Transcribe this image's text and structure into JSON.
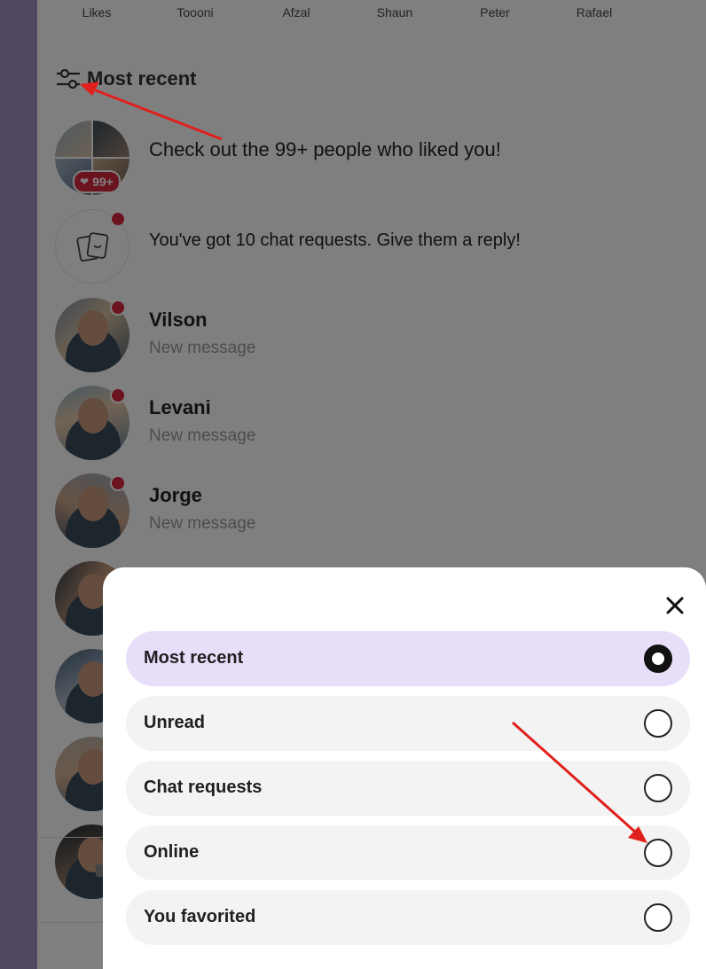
{
  "stories": [
    "Likes",
    "Toooni",
    "Afzal",
    "Shaun",
    "Peter",
    "Rafael"
  ],
  "filter": {
    "label": "Most recent",
    "icon": "sliders-icon"
  },
  "likes_row": {
    "text": "Check out the 99+ people who liked you!",
    "badge": "99+"
  },
  "requests_row": {
    "text": "You've got 10 chat requests. Give them a reply!",
    "icon": "chat-cards-icon"
  },
  "conversations": [
    {
      "name": "Vilson",
      "preview": "New message"
    },
    {
      "name": "Levani",
      "preview": "New message"
    },
    {
      "name": "Jorge",
      "preview": "New message"
    }
  ],
  "sheet": {
    "close_icon": "close-icon",
    "options": [
      {
        "label": "Most recent",
        "selected": true
      },
      {
        "label": "Unread",
        "selected": false
      },
      {
        "label": "Chat requests",
        "selected": false
      },
      {
        "label": "Online",
        "selected": false
      },
      {
        "label": "You favorited",
        "selected": false
      }
    ]
  },
  "colors": {
    "rail": "#a391c3",
    "accent_red": "#d7263d",
    "selected_option": "#e8defa",
    "option_bg": "#f3f3f3",
    "annotation": "#e0201c"
  }
}
